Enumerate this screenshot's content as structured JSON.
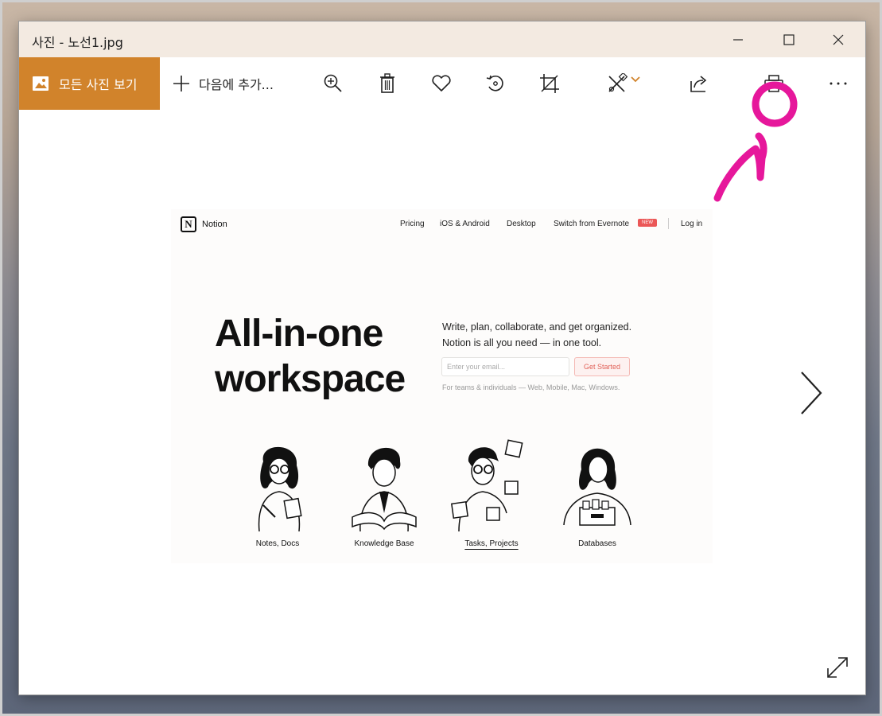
{
  "window": {
    "title": "사진 - 노선1.jpg"
  },
  "toolbar": {
    "all_photos_label": "모든 사진 보기",
    "add_to_label": "다음에 추가...",
    "icons": [
      "zoom-in-icon",
      "trash-icon",
      "heart-icon",
      "rotate-icon",
      "crop-icon",
      "edit-create-icon",
      "share-icon",
      "print-icon",
      "more-icon"
    ]
  },
  "photo": {
    "brand": "Notion",
    "logo_letter": "N",
    "nav": {
      "pricing": "Pricing",
      "ios_android": "iOS & Android",
      "desktop": "Desktop",
      "switch_evernote": "Switch from Evernote",
      "new_badge": "NEW",
      "login": "Log in"
    },
    "hero_line1": "All-in-one",
    "hero_line2": "workspace",
    "sub_line1": "Write, plan, collaborate, and get organized.",
    "sub_line2": "Notion is all you need — in one tool.",
    "email_placeholder": "Enter your email...",
    "get_started": "Get Started",
    "note": "For teams & individuals — Web, Mobile, Mac, Windows.",
    "captions": {
      "notes": "Notes, Docs",
      "kb": "Knowledge Base",
      "tasks": "Tasks, Projects",
      "db": "Databases"
    }
  },
  "colors": {
    "accent": "#d1832b",
    "titlebar": "#f3eae1",
    "annotation": "#e6179b"
  }
}
